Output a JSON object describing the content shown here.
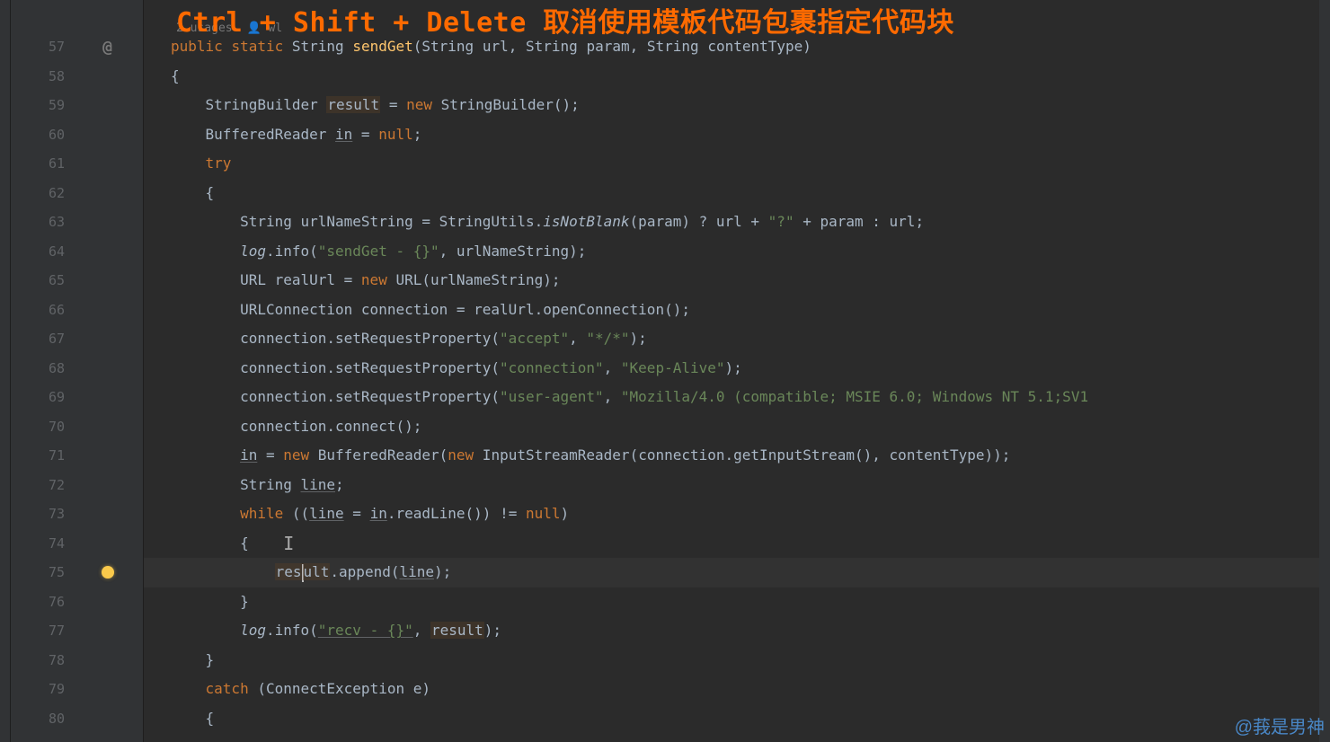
{
  "overlay": {
    "title_en": "Ctrl + Shift + Delete ",
    "title_cn": "取消使用模板代码包裹指定代码块"
  },
  "inlay": {
    "usages": "2 usages",
    "author": "wl"
  },
  "gutter": {
    "start": 57,
    "end": 80
  },
  "icons": {
    "at": "@",
    "bulb_line": 75
  },
  "code": {
    "l57": {
      "kw1": "public",
      "kw2": "static",
      "type": "String",
      "name": "sendGet",
      "p1t": "String",
      "p1": "url",
      "p2t": "String",
      "p2": "param",
      "p3t": "String",
      "p3": "contentType"
    },
    "l58": {
      "brace": "{"
    },
    "l59": {
      "t": "StringBuilder ",
      "v": "result",
      "eq": " = ",
      "kw": "new",
      "rest": " StringBuilder();"
    },
    "l60": {
      "t": "BufferedReader ",
      "v": "in",
      "eq": " = ",
      "kw": "null",
      "semi": ";"
    },
    "l61": {
      "kw": "try"
    },
    "l62": {
      "brace": "{"
    },
    "l63": {
      "a": "String urlNameString = StringUtils.",
      "m": "isNotBlank",
      "b": "(param) ? url + ",
      "s": "\"?\"",
      "c": " + param : url;"
    },
    "l64": {
      "obj": "log",
      "dot": ".info(",
      "s": "\"sendGet - {}\"",
      "rest": ", urlNameString);"
    },
    "l65": {
      "a": "URL realUrl = ",
      "kw": "new",
      "b": " URL(urlNameString);"
    },
    "l66": {
      "a": "URLConnection connection = realUrl.openConnection();"
    },
    "l67": {
      "a": "connection.setRequestProperty(",
      "s1": "\"accept\"",
      "c": ", ",
      "s2": "\"*/*\"",
      "e": ");"
    },
    "l68": {
      "a": "connection.setRequestProperty(",
      "s1": "\"connection\"",
      "c": ", ",
      "s2": "\"Keep-Alive\"",
      "e": ");"
    },
    "l69": {
      "a": "connection.setRequestProperty(",
      "s1": "\"user-agent\"",
      "c": ", ",
      "s2": "\"Mozilla/4.0 (compatible; MSIE 6.0; Windows NT 5.1;SV1",
      "e": ""
    },
    "l70": {
      "a": "connection.connect();"
    },
    "l71": {
      "v": "in",
      "eq": " = ",
      "kw1": "new",
      "b": " BufferedReader(",
      "kw2": "new",
      "c": " InputStreamReader(connection.getInputStream(), contentType));"
    },
    "l72": {
      "a": "String ",
      "v": "line",
      "semi": ";"
    },
    "l73": {
      "kw": "while",
      "a": " ((",
      "v1": "line",
      "b": " = ",
      "v2": "in",
      "c": ".readLine()) != ",
      "kw2": "null",
      "d": ")"
    },
    "l74": {
      "brace": "{"
    },
    "l75": {
      "v1": "res",
      "v1b": "ult",
      "dot": ".append(",
      "v2": "line",
      "e": ");"
    },
    "l76": {
      "brace": "}"
    },
    "l77": {
      "obj": "log",
      "dot": ".info(",
      "s": "\"recv - {}\"",
      "c": ", ",
      "v": "result",
      "e": ");"
    },
    "l78": {
      "brace": "}"
    },
    "l79": {
      "kw": "catch",
      "a": " (ConnectException e)"
    },
    "l80": {
      "brace": "{"
    }
  },
  "watermark": "@莪是男神"
}
